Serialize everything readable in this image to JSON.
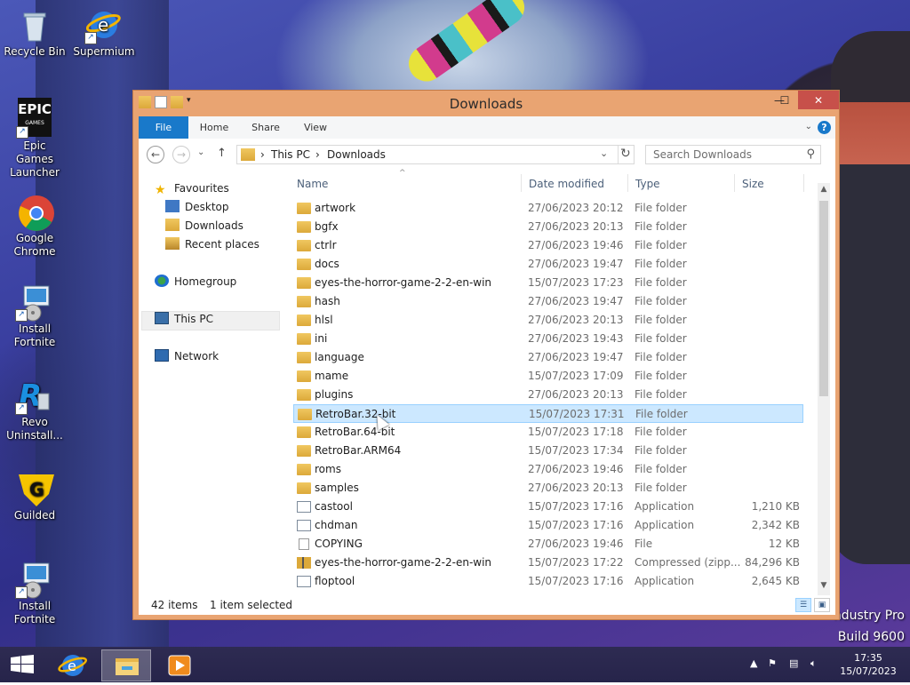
{
  "desktop": {
    "icons": [
      {
        "label": "Recycle Bin",
        "icon": "recycle-bin-icon"
      },
      {
        "label": "Supermium",
        "icon": "supermium-icon"
      },
      {
        "label": "Epic Games Launcher",
        "icon": "epic-games-icon"
      },
      {
        "label": "Google Chrome",
        "icon": "chrome-icon"
      },
      {
        "label": "Install Fortnite",
        "icon": "installer-icon"
      },
      {
        "label": "Revo Uninstall...",
        "icon": "revo-uninstaller-icon"
      },
      {
        "label": "Guilded",
        "icon": "guilded-icon"
      },
      {
        "label": "Install Fortnite",
        "icon": "installer-icon"
      }
    ],
    "epic_logo_text": "EPIC",
    "epic_logo_sub": "GAMES",
    "watermark": {
      "line1": "ndustry Pro",
      "line2": "Build 9600"
    }
  },
  "window": {
    "title": "Downloads",
    "controls": {
      "minimize": "—",
      "maximize": "☐",
      "close": "✕"
    },
    "ribbon": {
      "tabs": [
        "File",
        "Home",
        "Share",
        "View"
      ],
      "help": "?",
      "expand": "⌄"
    },
    "nav": {
      "back": "←",
      "forward": "→",
      "recent": "⌄",
      "up": "↑",
      "breadcrumb": [
        "This PC",
        "Downloads"
      ],
      "separator": "›",
      "dropdown": "⌄",
      "refresh": "↻",
      "search_placeholder": "Search Downloads",
      "search_icon": "⚲"
    },
    "navpane": {
      "favourites": "Favourites",
      "desktop": "Desktop",
      "downloads": "Downloads",
      "recent_places": "Recent places",
      "homegroup": "Homegroup",
      "this_pc": "This PC",
      "network": "Network"
    },
    "columns": {
      "name": "Name",
      "date": "Date modified",
      "type": "Type",
      "size": "Size",
      "sort_arrow": "^"
    },
    "files": [
      {
        "name": "artwork",
        "date": "27/06/2023 20:12",
        "type": "File folder",
        "size": "",
        "kind": "folder"
      },
      {
        "name": "bgfx",
        "date": "27/06/2023 20:13",
        "type": "File folder",
        "size": "",
        "kind": "folder"
      },
      {
        "name": "ctrlr",
        "date": "27/06/2023 19:46",
        "type": "File folder",
        "size": "",
        "kind": "folder"
      },
      {
        "name": "docs",
        "date": "27/06/2023 19:47",
        "type": "File folder",
        "size": "",
        "kind": "folder"
      },
      {
        "name": "eyes-the-horror-game-2-2-en-win",
        "date": "15/07/2023 17:23",
        "type": "File folder",
        "size": "",
        "kind": "folder"
      },
      {
        "name": "hash",
        "date": "27/06/2023 19:47",
        "type": "File folder",
        "size": "",
        "kind": "folder"
      },
      {
        "name": "hlsl",
        "date": "27/06/2023 20:13",
        "type": "File folder",
        "size": "",
        "kind": "folder"
      },
      {
        "name": "ini",
        "date": "27/06/2023 19:43",
        "type": "File folder",
        "size": "",
        "kind": "folder"
      },
      {
        "name": "language",
        "date": "27/06/2023 19:47",
        "type": "File folder",
        "size": "",
        "kind": "folder"
      },
      {
        "name": "mame",
        "date": "15/07/2023 17:09",
        "type": "File folder",
        "size": "",
        "kind": "folder"
      },
      {
        "name": "plugins",
        "date": "27/06/2023 20:13",
        "type": "File folder",
        "size": "",
        "kind": "folder"
      },
      {
        "name": "RetroBar.32-bit",
        "date": "15/07/2023 17:31",
        "type": "File folder",
        "size": "",
        "kind": "folder",
        "selected": true
      },
      {
        "name": "RetroBar.64-bit",
        "date": "15/07/2023 17:18",
        "type": "File folder",
        "size": "",
        "kind": "folder"
      },
      {
        "name": "RetroBar.ARM64",
        "date": "15/07/2023 17:34",
        "type": "File folder",
        "size": "",
        "kind": "folder"
      },
      {
        "name": "roms",
        "date": "27/06/2023 19:46",
        "type": "File folder",
        "size": "",
        "kind": "folder"
      },
      {
        "name": "samples",
        "date": "27/06/2023 20:13",
        "type": "File folder",
        "size": "",
        "kind": "folder"
      },
      {
        "name": "castool",
        "date": "15/07/2023 17:16",
        "type": "Application",
        "size": "1,210 KB",
        "kind": "app"
      },
      {
        "name": "chdman",
        "date": "15/07/2023 17:16",
        "type": "Application",
        "size": "2,342 KB",
        "kind": "app"
      },
      {
        "name": "COPYING",
        "date": "27/06/2023 19:46",
        "type": "File",
        "size": "12 KB",
        "kind": "file"
      },
      {
        "name": "eyes-the-horror-game-2-2-en-win",
        "date": "15/07/2023 17:22",
        "type": "Compressed (zipp...",
        "size": "84,296 KB",
        "kind": "zip"
      },
      {
        "name": "floptool",
        "date": "15/07/2023 17:16",
        "type": "Application",
        "size": "2,645 KB",
        "kind": "app"
      }
    ],
    "status": {
      "items": "42 items",
      "selected": "1 item selected"
    },
    "scroll": {
      "up": "▲",
      "down": "▼"
    }
  },
  "taskbar": {
    "clock_time": "17:35",
    "clock_date": "15/07/2023",
    "tray_expand": "▲"
  }
}
